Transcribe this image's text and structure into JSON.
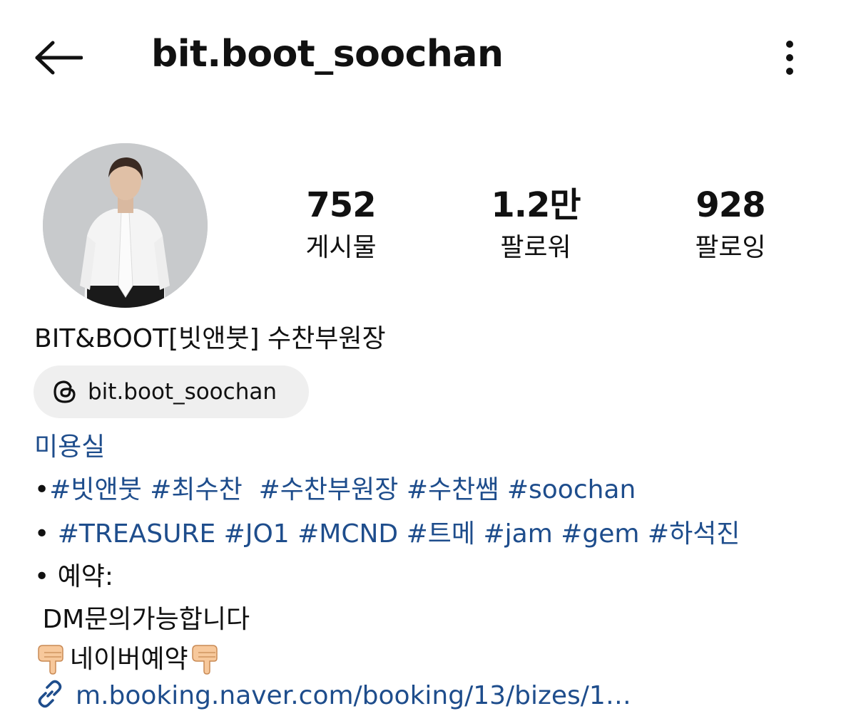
{
  "header": {
    "back_icon": "arrow-left-icon",
    "title": "bit.boot_soochan",
    "more_icon": "more-vertical-icon"
  },
  "profile": {
    "avatar_alt": "profile photo",
    "stats": [
      {
        "value": "752",
        "label": "게시물"
      },
      {
        "value": "1.2만",
        "label": "팔로워"
      },
      {
        "value": "928",
        "label": "팔로잉"
      }
    ]
  },
  "bio": {
    "name": "BIT&BOOT[빗앤붓] 수찬부원장",
    "threads": {
      "icon": "threads-icon",
      "handle": "bit.boot_soochan"
    },
    "category": "미용실",
    "line1": {
      "bullet": "•",
      "tags": [
        "#빗앤붓",
        "#최수찬",
        "#수찬부원장",
        "#수찬쌤",
        "#soochan"
      ]
    },
    "line2": {
      "bullet": "•",
      "tags": [
        "#TREASURE",
        "#JO1",
        "#MCND",
        "#트메",
        "#jam",
        "#gem",
        "#하석진"
      ]
    },
    "line3": "• 예약:",
    "line4": " DM문의가능합니다",
    "line5": {
      "text": "네이버예약",
      "emoji_icon": "pointing-down-hand-icon"
    },
    "link": {
      "icon": "link-icon",
      "text": "m.booking.naver.com/booking/13/bizes/1…"
    }
  },
  "colors": {
    "link_blue": "#1e4d8c",
    "chip_bg": "#efefef",
    "text": "#111111"
  }
}
